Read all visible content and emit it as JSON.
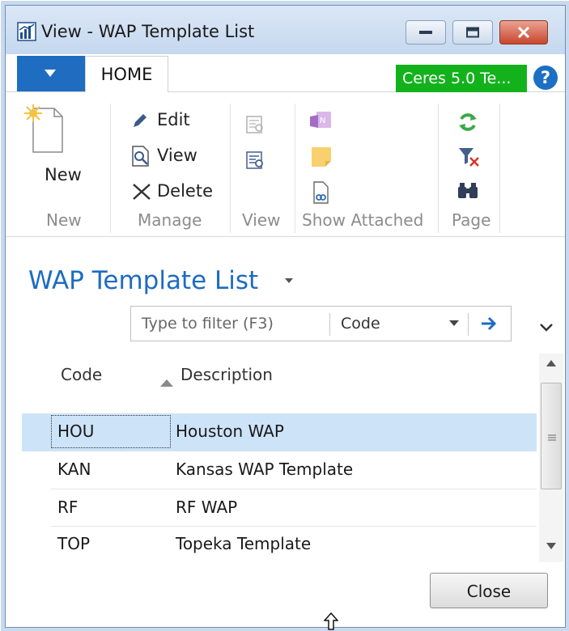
{
  "window": {
    "title": "View - WAP Template List"
  },
  "ribbon": {
    "tab": "HOME",
    "company": "Ceres 5.0 Te...",
    "help": "?",
    "groups": {
      "new_label": "New",
      "manage_label": "Manage",
      "view_label": "View",
      "show_attached_label": "Show Attached",
      "page_label": "Page"
    },
    "commands": {
      "new": "New",
      "edit": "Edit",
      "view": "View",
      "delete": "Delete"
    }
  },
  "page": {
    "title": "WAP Template List"
  },
  "filter": {
    "placeholder": "Type to filter (F3)",
    "field": "Code"
  },
  "list": {
    "columns": [
      "Code",
      "Description"
    ],
    "rows": [
      {
        "code": "HOU",
        "description": "Houston WAP"
      },
      {
        "code": "KAN",
        "description": "Kansas WAP Template"
      },
      {
        "code": "RF",
        "description": "RF WAP"
      },
      {
        "code": "TOP",
        "description": "Topeka Template"
      }
    ]
  },
  "footer": {
    "close_label": "Close"
  },
  "colors": {
    "accent": "#1e6cc2",
    "company_badge": "#13b21c",
    "selected_row": "#cde3f8"
  }
}
